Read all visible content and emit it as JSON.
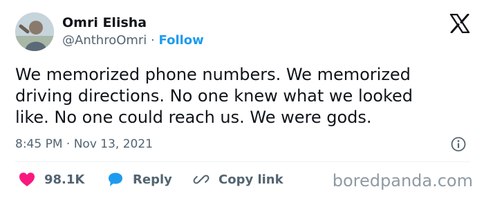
{
  "author": {
    "name": "Omri Elisha",
    "handle": "@AnthroOmri",
    "separator": "·",
    "follow_label": "Follow"
  },
  "tweet": {
    "text": "We memorized phone numbers. We memorized\ndriving directions. No one knew what we looked\nlike. No one could reach us. We were gods.",
    "time": "8:45 PM",
    "separator": "·",
    "date": "Nov 13, 2021"
  },
  "actions": {
    "like_count": "98.1K",
    "reply_label": "Reply",
    "copy_label": "Copy link"
  },
  "watermark": "boredpanda.com",
  "colors": {
    "accent": "#1d9bf0",
    "like": "#f91880",
    "text": "#0f1419",
    "secondary": "#536471"
  },
  "icons": {
    "brand": "x-logo-icon",
    "info": "info-icon",
    "like": "heart-icon",
    "reply": "speech-bubble-icon",
    "copy": "link-icon"
  }
}
